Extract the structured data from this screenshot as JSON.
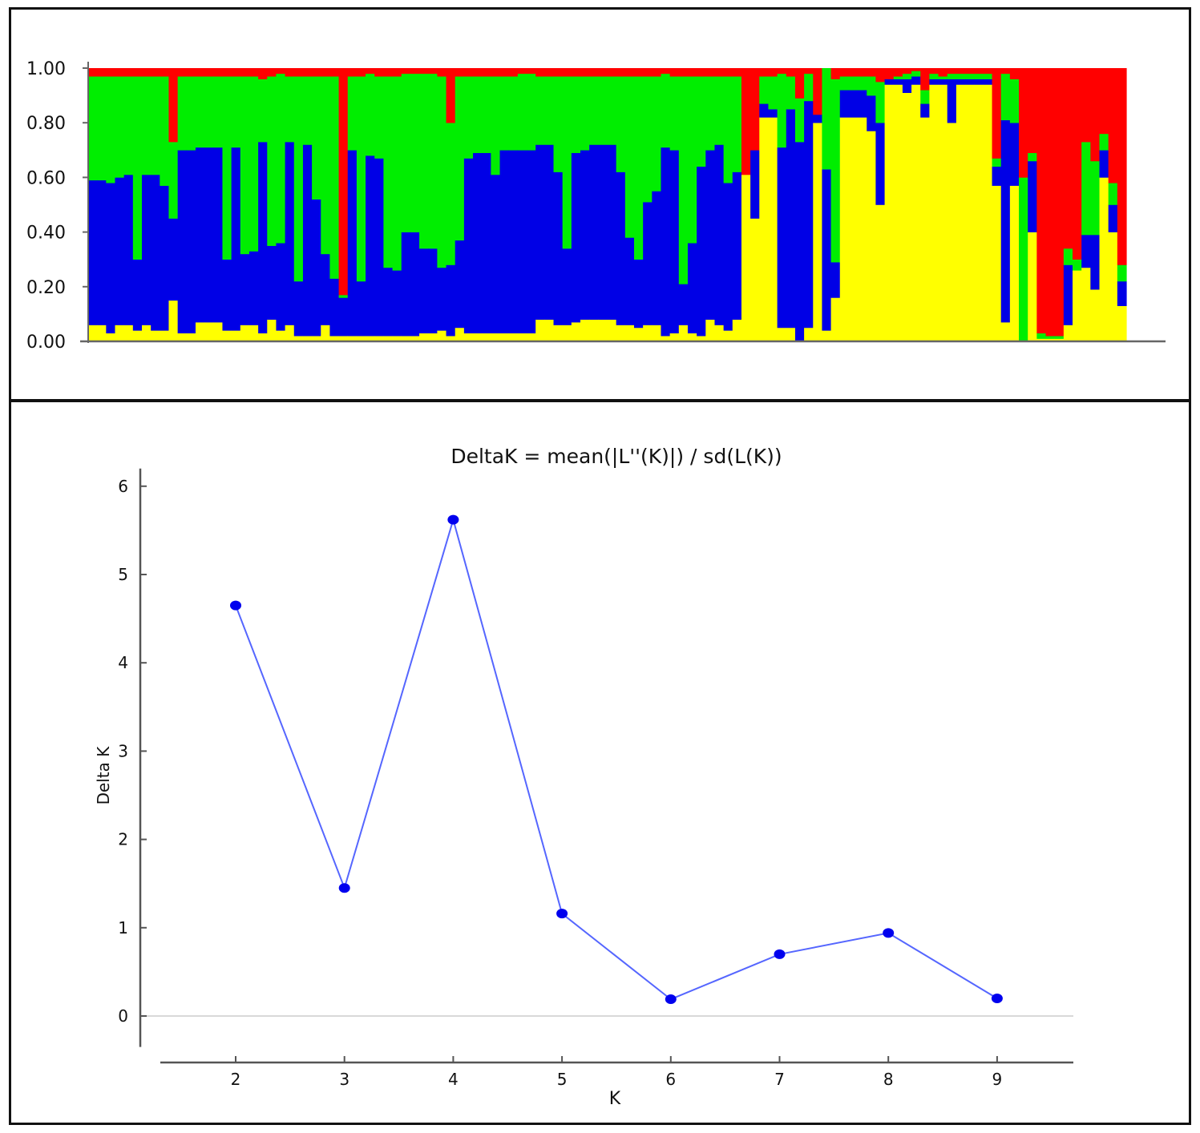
{
  "colors": {
    "cluster_red": "#ff0000",
    "cluster_green": "#00ee00",
    "cluster_blue": "#0000e6",
    "cluster_yellow": "#ffff00",
    "line_blue": "#5566ff",
    "point_blue": "#0000ee"
  },
  "chart_data": [
    {
      "type": "bar",
      "stacked": true,
      "normalized": true,
      "title": "",
      "xlabel": "",
      "ylabel": "",
      "ylim": [
        0,
        1
      ],
      "yticks": [
        "1.00",
        "0.80",
        "0.60",
        "0.40",
        "0.20",
        "0.00"
      ],
      "ytick_values": [
        1.0,
        0.8,
        0.6,
        0.4,
        0.2,
        0.0
      ],
      "stack_order": [
        "yellow",
        "blue",
        "green",
        "red"
      ],
      "individuals": [
        [
          0.06,
          0.53,
          0.38,
          0.03
        ],
        [
          0.06,
          0.53,
          0.38,
          0.03
        ],
        [
          0.03,
          0.55,
          0.39,
          0.03
        ],
        [
          0.06,
          0.54,
          0.37,
          0.03
        ],
        [
          0.06,
          0.55,
          0.36,
          0.03
        ],
        [
          0.04,
          0.26,
          0.67,
          0.03
        ],
        [
          0.06,
          0.55,
          0.36,
          0.03
        ],
        [
          0.04,
          0.57,
          0.36,
          0.03
        ],
        [
          0.04,
          0.53,
          0.4,
          0.03
        ],
        [
          0.15,
          0.3,
          0.28,
          0.27
        ],
        [
          0.03,
          0.67,
          0.27,
          0.03
        ],
        [
          0.03,
          0.67,
          0.27,
          0.03
        ],
        [
          0.07,
          0.64,
          0.26,
          0.03
        ],
        [
          0.07,
          0.64,
          0.26,
          0.03
        ],
        [
          0.07,
          0.64,
          0.26,
          0.03
        ],
        [
          0.04,
          0.26,
          0.67,
          0.03
        ],
        [
          0.04,
          0.67,
          0.26,
          0.03
        ],
        [
          0.06,
          0.26,
          0.65,
          0.03
        ],
        [
          0.06,
          0.27,
          0.64,
          0.03
        ],
        [
          0.03,
          0.7,
          0.23,
          0.04
        ],
        [
          0.08,
          0.27,
          0.62,
          0.03
        ],
        [
          0.04,
          0.32,
          0.62,
          0.02
        ],
        [
          0.06,
          0.67,
          0.24,
          0.03
        ],
        [
          0.02,
          0.2,
          0.75,
          0.03
        ],
        [
          0.02,
          0.7,
          0.25,
          0.03
        ],
        [
          0.02,
          0.5,
          0.45,
          0.03
        ],
        [
          0.06,
          0.26,
          0.65,
          0.03
        ],
        [
          0.02,
          0.21,
          0.74,
          0.03
        ],
        [
          0.02,
          0.14,
          0.01,
          0.83
        ],
        [
          0.02,
          0.68,
          0.27,
          0.03
        ],
        [
          0.02,
          0.2,
          0.75,
          0.03
        ],
        [
          0.02,
          0.66,
          0.3,
          0.02
        ],
        [
          0.02,
          0.65,
          0.3,
          0.03
        ],
        [
          0.02,
          0.25,
          0.7,
          0.03
        ],
        [
          0.02,
          0.24,
          0.71,
          0.03
        ],
        [
          0.02,
          0.38,
          0.58,
          0.02
        ],
        [
          0.02,
          0.38,
          0.58,
          0.02
        ],
        [
          0.03,
          0.31,
          0.64,
          0.02
        ],
        [
          0.03,
          0.31,
          0.64,
          0.02
        ],
        [
          0.04,
          0.23,
          0.7,
          0.03
        ],
        [
          0.02,
          0.26,
          0.52,
          0.2
        ],
        [
          0.05,
          0.32,
          0.6,
          0.03
        ],
        [
          0.03,
          0.64,
          0.3,
          0.03
        ],
        [
          0.03,
          0.66,
          0.28,
          0.03
        ],
        [
          0.03,
          0.66,
          0.28,
          0.03
        ],
        [
          0.03,
          0.58,
          0.36,
          0.03
        ],
        [
          0.03,
          0.67,
          0.27,
          0.03
        ],
        [
          0.03,
          0.67,
          0.27,
          0.03
        ],
        [
          0.03,
          0.67,
          0.28,
          0.02
        ],
        [
          0.03,
          0.67,
          0.28,
          0.02
        ],
        [
          0.08,
          0.64,
          0.25,
          0.03
        ],
        [
          0.08,
          0.64,
          0.25,
          0.03
        ],
        [
          0.06,
          0.56,
          0.35,
          0.03
        ],
        [
          0.06,
          0.28,
          0.63,
          0.03
        ],
        [
          0.07,
          0.62,
          0.28,
          0.03
        ],
        [
          0.08,
          0.62,
          0.27,
          0.03
        ],
        [
          0.08,
          0.64,
          0.25,
          0.03
        ],
        [
          0.08,
          0.64,
          0.25,
          0.03
        ],
        [
          0.08,
          0.64,
          0.25,
          0.03
        ],
        [
          0.06,
          0.56,
          0.35,
          0.03
        ],
        [
          0.06,
          0.32,
          0.59,
          0.03
        ],
        [
          0.05,
          0.25,
          0.67,
          0.03
        ],
        [
          0.06,
          0.45,
          0.46,
          0.03
        ],
        [
          0.06,
          0.49,
          0.42,
          0.03
        ],
        [
          0.02,
          0.69,
          0.27,
          0.02
        ],
        [
          0.03,
          0.67,
          0.27,
          0.03
        ],
        [
          0.06,
          0.15,
          0.76,
          0.03
        ],
        [
          0.03,
          0.33,
          0.61,
          0.03
        ],
        [
          0.02,
          0.62,
          0.33,
          0.03
        ],
        [
          0.08,
          0.62,
          0.27,
          0.03
        ],
        [
          0.06,
          0.66,
          0.25,
          0.03
        ],
        [
          0.04,
          0.54,
          0.39,
          0.03
        ],
        [
          0.08,
          0.54,
          0.35,
          0.03
        ],
        [
          0.61,
          0.0,
          0.0,
          0.39
        ],
        [
          0.45,
          0.25,
          0.0,
          0.3
        ],
        [
          0.82,
          0.05,
          0.1,
          0.03
        ],
        [
          0.82,
          0.03,
          0.12,
          0.03
        ],
        [
          0.05,
          0.66,
          0.27,
          0.02
        ],
        [
          0.05,
          0.8,
          0.12,
          0.03
        ],
        [
          0.0,
          0.73,
          0.16,
          0.11
        ],
        [
          0.05,
          0.83,
          0.1,
          0.02
        ],
        [
          0.8,
          0.03,
          0.0,
          0.17
        ],
        [
          0.04,
          0.59,
          0.37,
          0.0
        ],
        [
          0.16,
          0.13,
          0.67,
          0.04
        ],
        [
          0.82,
          0.1,
          0.05,
          0.03
        ],
        [
          0.82,
          0.1,
          0.05,
          0.03
        ],
        [
          0.82,
          0.1,
          0.05,
          0.03
        ],
        [
          0.77,
          0.13,
          0.07,
          0.03
        ],
        [
          0.5,
          0.3,
          0.15,
          0.05
        ],
        [
          0.94,
          0.02,
          0.0,
          0.04
        ],
        [
          0.94,
          0.02,
          0.01,
          0.03
        ],
        [
          0.91,
          0.05,
          0.02,
          0.02
        ],
        [
          0.94,
          0.03,
          0.02,
          0.01
        ],
        [
          0.82,
          0.05,
          0.05,
          0.08
        ],
        [
          0.94,
          0.02,
          0.02,
          0.02
        ],
        [
          0.94,
          0.02,
          0.01,
          0.03
        ],
        [
          0.8,
          0.16,
          0.02,
          0.02
        ],
        [
          0.94,
          0.02,
          0.02,
          0.02
        ],
        [
          0.94,
          0.02,
          0.02,
          0.02
        ],
        [
          0.94,
          0.02,
          0.02,
          0.02
        ],
        [
          0.94,
          0.02,
          0.02,
          0.02
        ],
        [
          0.57,
          0.07,
          0.03,
          0.33
        ],
        [
          0.07,
          0.74,
          0.17,
          0.02
        ],
        [
          0.57,
          0.23,
          0.16,
          0.04
        ],
        [
          0.0,
          0.0,
          0.6,
          0.4
        ],
        [
          0.4,
          0.26,
          0.03,
          0.31
        ],
        [
          0.01,
          0.0,
          0.02,
          0.97
        ],
        [
          0.01,
          0.0,
          0.01,
          0.98
        ],
        [
          0.01,
          0.0,
          0.01,
          0.98
        ],
        [
          0.06,
          0.22,
          0.06,
          0.66
        ],
        [
          0.26,
          0.0,
          0.04,
          0.7
        ],
        [
          0.27,
          0.12,
          0.34,
          0.27
        ],
        [
          0.19,
          0.2,
          0.27,
          0.34
        ],
        [
          0.6,
          0.1,
          0.06,
          0.24
        ],
        [
          0.4,
          0.1,
          0.08,
          0.42
        ],
        [
          0.13,
          0.09,
          0.06,
          0.72
        ]
      ]
    },
    {
      "type": "line",
      "title": "DeltaK = mean(|L''(K)|) / sd(L(K))",
      "xlabel": "K",
      "ylabel": "Delta K",
      "x": [
        2,
        3,
        4,
        5,
        6,
        7,
        8,
        9
      ],
      "y": [
        4.65,
        1.45,
        5.62,
        1.16,
        0.19,
        0.7,
        0.94,
        0.2
      ],
      "xticks": [
        "2",
        "3",
        "4",
        "5",
        "6",
        "7",
        "8",
        "9"
      ],
      "yticks": [
        "0",
        "1",
        "2",
        "3",
        "4",
        "5",
        "6"
      ],
      "xlim": [
        1.35,
        9.7
      ],
      "ylim": [
        -0.35,
        6.15
      ],
      "zero_line": true
    }
  ]
}
